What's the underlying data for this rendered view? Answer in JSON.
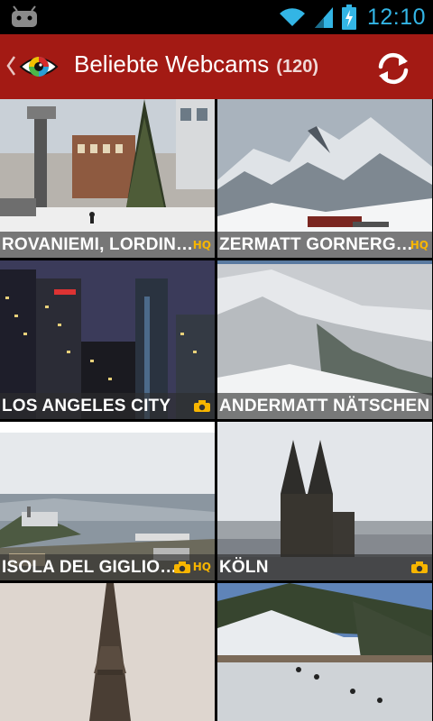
{
  "status_bar": {
    "time": "12:10",
    "icons": [
      "android-notification-icon",
      "wifi-icon",
      "signal-icon",
      "battery-charging-icon"
    ]
  },
  "action_bar": {
    "title": "Beliebte Webcams",
    "count": "(120)",
    "icons": [
      "up-caret-icon",
      "webcam-eye-logo-icon",
      "refresh-icon"
    ]
  },
  "webcams": [
    {
      "name": "ROVANIEMI, LORDIN…",
      "hq": "HQ",
      "cam_badge": false
    },
    {
      "name": "ZERMATT GORNERG…",
      "hq": "HQ",
      "cam_badge": false
    },
    {
      "name": "LOS ANGELES CITY",
      "hq": "",
      "cam_badge": true
    },
    {
      "name": "ANDERMATT NÄTSCHEN",
      "hq": "",
      "cam_badge": false
    },
    {
      "name": "ISOLA DEL GIGLIO…",
      "hq": "HQ",
      "cam_badge": true
    },
    {
      "name": "KÖLN",
      "hq": "",
      "cam_badge": true
    },
    {
      "name": "",
      "hq": "",
      "cam_badge": false
    },
    {
      "name": "",
      "hq": "",
      "cam_badge": false
    }
  ],
  "colors": {
    "action_bar": "#a31a14",
    "status_time": "#33b5e5",
    "hq_badge": "#f7b500"
  }
}
